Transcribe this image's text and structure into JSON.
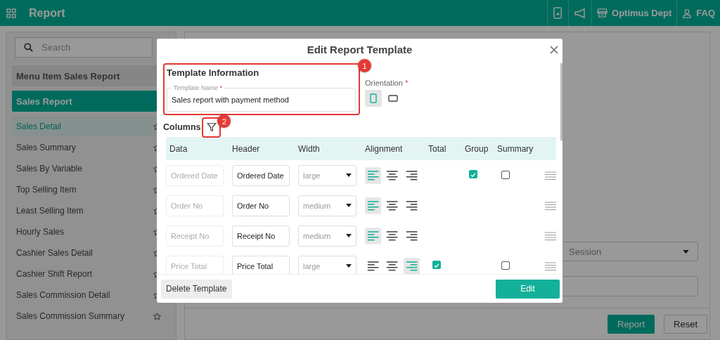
{
  "topbar": {
    "title": "Report",
    "department": "Optimus Dept",
    "help": "FAQ"
  },
  "sidebar": {
    "search": {
      "placeholder": "Search"
    },
    "groups": [
      {
        "label": "Menu Item Sales Report",
        "selected": false
      },
      {
        "label": "Sales Report",
        "selected": true
      }
    ],
    "items": [
      {
        "label": "Sales Detail",
        "selected": true
      },
      {
        "label": "Sales Summary",
        "selected": false
      },
      {
        "label": "Sales By Variable",
        "selected": false
      },
      {
        "label": "Top Selling Item",
        "selected": false
      },
      {
        "label": "Least Selling Item",
        "selected": false
      },
      {
        "label": "Hourly Sales",
        "selected": false
      },
      {
        "label": "Cashier Sales Detail",
        "selected": false
      },
      {
        "label": "Cashier Shift Report",
        "selected": false
      },
      {
        "label": "Sales Commission Detail",
        "selected": false
      },
      {
        "label": "Sales Commission Summary",
        "selected": false
      }
    ]
  },
  "main": {
    "session_select": {
      "value": "Session"
    },
    "buttons": [
      {
        "label": "Report",
        "kind": "primary"
      },
      {
        "label": "Reset",
        "kind": "secondary"
      }
    ]
  },
  "modal": {
    "title": "Edit Report Template",
    "template_info": {
      "heading": "Template Information",
      "field": {
        "label": "Template Name",
        "required_mark": "*",
        "value": "Sales report with payment method"
      }
    },
    "orientation": {
      "label": "Orientation",
      "required_mark": "*",
      "options": [
        {
          "kind": "portrait",
          "selected": true
        },
        {
          "kind": "landscape",
          "selected": false
        }
      ]
    },
    "columns": {
      "heading": "Columns",
      "headers": [
        "Data",
        "Header",
        "Width",
        "Alignment",
        "Total",
        "Group",
        "Summary"
      ],
      "rows": [
        {
          "data": "Ordered Date",
          "header": "Ordered Date",
          "width": "large",
          "alignment": [
            {
              "kind": "left",
              "selected": true
            },
            {
              "kind": "center",
              "selected": false
            },
            {
              "kind": "right",
              "selected": false
            }
          ],
          "group": true,
          "summary": false
        },
        {
          "data": "Order No",
          "header": "Order No",
          "width": "medium",
          "alignment": [
            {
              "kind": "left",
              "selected": true
            },
            {
              "kind": "center",
              "selected": false
            },
            {
              "kind": "right",
              "selected": false
            }
          ]
        },
        {
          "data": "Receipt No",
          "header": "Receipt No",
          "width": "medium",
          "alignment": [
            {
              "kind": "left",
              "selected": true
            },
            {
              "kind": "center",
              "selected": false
            },
            {
              "kind": "right",
              "selected": false
            }
          ]
        },
        {
          "data": "Price Total",
          "header": "Price Total",
          "width": "large",
          "alignment": [
            {
              "kind": "left",
              "selected": false
            },
            {
              "kind": "center",
              "selected": false
            },
            {
              "kind": "right",
              "selected": true
            }
          ],
          "total": true,
          "summary": false
        }
      ]
    },
    "footer": {
      "delete": "Delete Template",
      "edit": "Edit"
    },
    "callouts": [
      {
        "number": "1"
      },
      {
        "number": "2"
      }
    ]
  }
}
